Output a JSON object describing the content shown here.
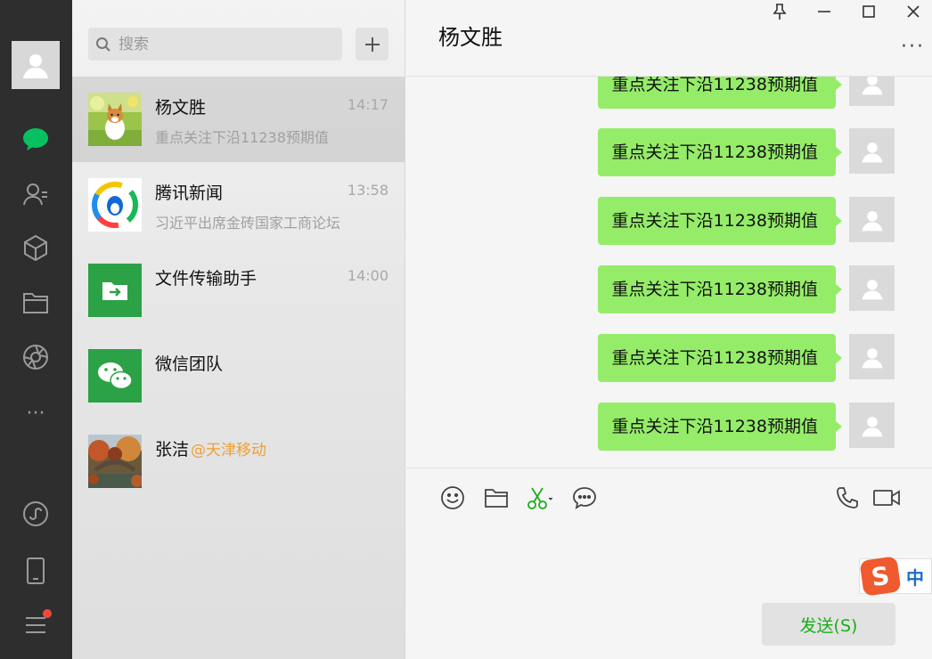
{
  "nav": {
    "items": [
      "chat-icon",
      "contacts-icon",
      "favorites-icon",
      "files-icon",
      "moments-icon",
      "more-icon",
      "miniprogram-icon",
      "phone-icon",
      "menu-icon"
    ]
  },
  "search": {
    "placeholder": "搜索"
  },
  "chats": [
    {
      "name": "杨文胜",
      "time": "14:17",
      "preview": "重点关注下沿11238预期值",
      "active": true
    },
    {
      "name": "腾讯新闻",
      "time": "13:58",
      "preview": "习近平出席金砖国家工商论坛",
      "active": false
    },
    {
      "name": "文件传输助手",
      "time": "14:00",
      "preview": "",
      "active": false
    },
    {
      "name": "微信团队",
      "time": "",
      "preview": "",
      "active": false
    },
    {
      "name": "张洁",
      "tag": "@天津移动",
      "time": "",
      "preview": "",
      "active": false
    }
  ],
  "conversation": {
    "title": "杨文胜",
    "more": "···",
    "messages": [
      "重点关注下沿11238预期值",
      "重点关注下沿11238预期值",
      "重点关注下沿11238预期值",
      "重点关注下沿11238预期值",
      "重点关注下沿11238预期值",
      "重点关注下沿11238预期值"
    ]
  },
  "input": {
    "send_label": "发送(S)"
  },
  "ime": {
    "s": "S",
    "mode": "中"
  },
  "colors": {
    "bubble": "#95ec69",
    "accent": "#1aad19",
    "nav_bg": "#2e2e2e"
  }
}
